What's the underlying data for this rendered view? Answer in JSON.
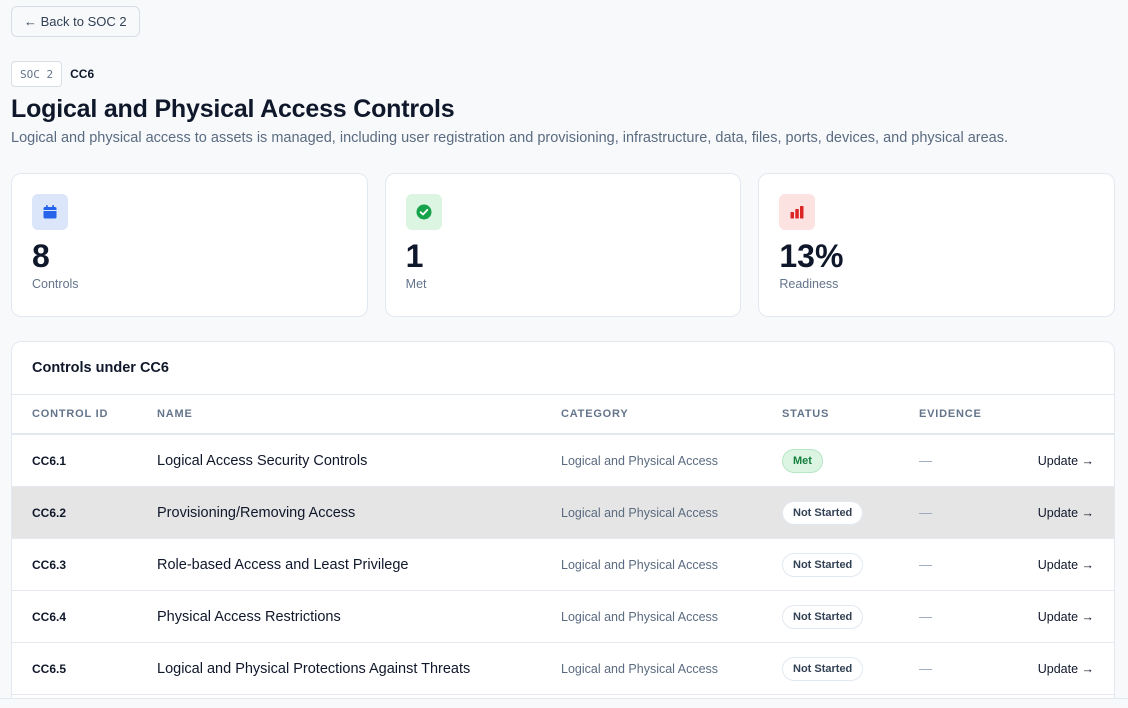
{
  "back_label": "← Back to SOC 2",
  "breadcrumb": {
    "framework": "SOC 2",
    "code": "CC6"
  },
  "page": {
    "title": "Logical and Physical Access Controls",
    "subtitle": "Logical and physical access to assets is managed, including user registration and provisioning, infrastructure, data, files, ports, devices, and physical areas."
  },
  "stats": [
    {
      "value": "8",
      "label": "Controls",
      "icon": "calendar-icon",
      "icon_bg": "#dbe6fb",
      "icon_color": "#2563eb"
    },
    {
      "value": "1",
      "label": "Met",
      "icon": "check-circle-icon",
      "icon_bg": "#dcf5e3",
      "icon_color": "#16a34a"
    },
    {
      "value": "13%",
      "label": "Readiness",
      "icon": "bar-chart-icon",
      "icon_bg": "#fde2e2",
      "icon_color": "#dc2626"
    }
  ],
  "table": {
    "title": "Controls under CC6",
    "columns": [
      "Control ID",
      "Name",
      "Category",
      "Status",
      "Evidence"
    ],
    "rows": [
      {
        "id": "CC6.1",
        "name": "Logical Access Security Controls",
        "category": "Logical and Physical Access",
        "status": "Met",
        "evidence": "—",
        "action": "Update →"
      },
      {
        "id": "CC6.2",
        "name": "Provisioning/Removing Access",
        "category": "Logical and Physical Access",
        "status": "Not Started",
        "evidence": "—",
        "action": "Update →"
      },
      {
        "id": "CC6.3",
        "name": "Role-based Access and Least Privilege",
        "category": "Logical and Physical Access",
        "status": "Not Started",
        "evidence": "—",
        "action": "Update →"
      },
      {
        "id": "CC6.4",
        "name": "Physical Access Restrictions",
        "category": "Logical and Physical Access",
        "status": "Not Started",
        "evidence": "—",
        "action": "Update →"
      },
      {
        "id": "CC6.5",
        "name": "Logical and Physical Protections Against Threats",
        "category": "Logical and Physical Access",
        "status": "Not Started",
        "evidence": "—",
        "action": "Update →"
      }
    ]
  },
  "colors": {
    "accent": "#0f172a",
    "met": "#15803d",
    "muted": "#64748b"
  }
}
